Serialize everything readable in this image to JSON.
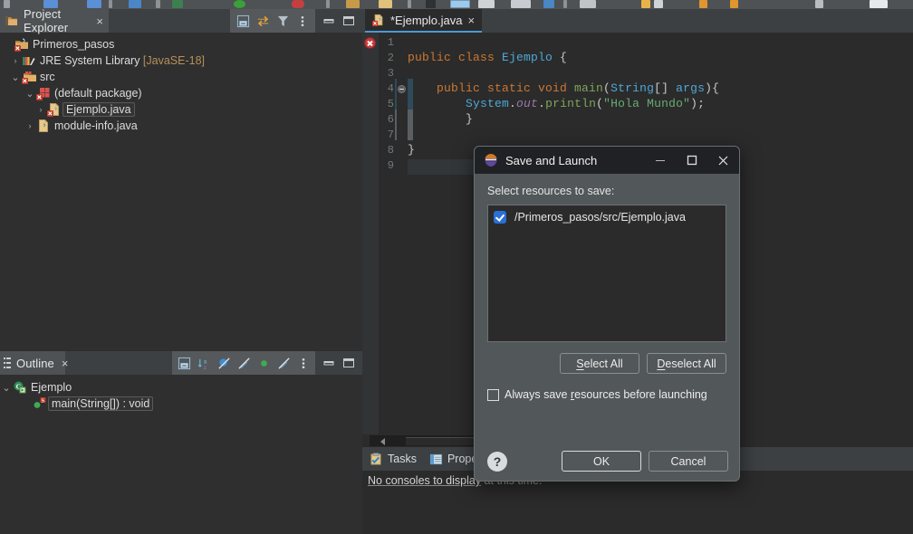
{
  "app": {
    "theme_bg": "#2f2f2f",
    "accent": "#4a9ad4"
  },
  "project_explorer": {
    "tab_label": "Project Explorer",
    "tab_close": "×",
    "tab_icon": "project-explorer-icon",
    "toolbar": [
      {
        "name": "collapse-all-icon",
        "glyph": ""
      },
      {
        "name": "link-with-editor-icon",
        "glyph": ""
      },
      {
        "name": "filter-icon",
        "glyph": ""
      },
      {
        "name": "view-menu-icon",
        "glyph": "⋮"
      },
      {
        "name": "minimize-view-icon",
        "glyph": ""
      },
      {
        "name": "maximize-view-icon",
        "glyph": ""
      }
    ],
    "tree": [
      {
        "twist": "",
        "indent": 0,
        "icon": "java-project-icon",
        "label": "Primeros_pasos",
        "suffix": "",
        "selected": false
      },
      {
        "twist": "›",
        "indent": 1,
        "icon": "jre-library-icon",
        "label": "JRE System Library ",
        "suffix": "[JavaSE-18]",
        "selected": false
      },
      {
        "twist": "⌄",
        "indent": 1,
        "icon": "source-folder-icon",
        "label": "src",
        "suffix": "",
        "selected": false
      },
      {
        "twist": "⌄",
        "indent": 2,
        "icon": "package-icon",
        "label": "(default package)",
        "suffix": "",
        "selected": false
      },
      {
        "twist": "›",
        "indent": 3,
        "icon": "java-file-icon",
        "label": "Ejemplo.java",
        "suffix": "",
        "selected": true
      },
      {
        "twist": "›",
        "indent": 2,
        "icon": "module-info-icon",
        "label": "module-info.java",
        "suffix": "",
        "selected": false
      }
    ]
  },
  "outline": {
    "tab_label": "Outline",
    "tab_close": "×",
    "tab_icon": "outline-icon",
    "toolbar": [
      {
        "name": "collapse-all-icon"
      },
      {
        "name": "sort-alphabetically-icon"
      },
      {
        "name": "hide-fields-icon"
      },
      {
        "name": "hide-static-members-icon"
      },
      {
        "name": "hide-non-public-icon"
      },
      {
        "name": "hide-local-types-icon"
      },
      {
        "name": "view-menu-icon"
      },
      {
        "name": "minimize-view-icon"
      },
      {
        "name": "maximize-view-icon"
      }
    ],
    "tree": [
      {
        "twist": "⌄",
        "indent": 0,
        "icon": "class-icon",
        "label": "Ejemplo"
      },
      {
        "twist": "",
        "indent": 1,
        "icon": "public-static-method-icon",
        "label": "main(String[]) : void"
      }
    ]
  },
  "editor": {
    "tab_label": "*Ejemplo.java",
    "tab_close": "×",
    "tab_icon": "java-file-icon",
    "error_marker": "error-marker-icon",
    "line_numbers": [
      "1",
      "2",
      "3",
      "4",
      "5",
      "6",
      "7",
      "8",
      "9"
    ],
    "current_line": 9,
    "code": [
      {
        "n": 1,
        "tokens": []
      },
      {
        "n": 2,
        "tokens": [
          {
            "t": "public class ",
            "c": "kw"
          },
          {
            "t": "Ejemplo",
            "c": "cls"
          },
          {
            "t": " {",
            "c": "pl"
          }
        ]
      },
      {
        "n": 3,
        "tokens": []
      },
      {
        "n": 4,
        "tokens": [
          {
            "t": "    public static void ",
            "c": "kw"
          },
          {
            "t": "main",
            "c": "mth"
          },
          {
            "t": "(",
            "c": "pl"
          },
          {
            "t": "String",
            "c": "ty"
          },
          {
            "t": "[] ",
            "c": "pl"
          },
          {
            "t": "args",
            "c": "ty"
          },
          {
            "t": "){",
            "c": "pl"
          }
        ]
      },
      {
        "n": 5,
        "tokens": [
          {
            "t": "        ",
            "c": "pl"
          },
          {
            "t": "System",
            "c": "ty"
          },
          {
            "t": ".",
            "c": "pl"
          },
          {
            "t": "out",
            "c": "fld"
          },
          {
            "t": ".",
            "c": "pl"
          },
          {
            "t": "println",
            "c": "mth"
          },
          {
            "t": "(",
            "c": "pl"
          },
          {
            "t": "\"Hola Mundo\"",
            "c": "st"
          },
          {
            "t": ");",
            "c": "pl"
          }
        ]
      },
      {
        "n": 6,
        "tokens": [
          {
            "t": "        }",
            "c": "pl"
          }
        ]
      },
      {
        "n": 7,
        "tokens": []
      },
      {
        "n": 8,
        "tokens": [
          {
            "t": "}",
            "c": "pl"
          }
        ]
      },
      {
        "n": 9,
        "tokens": []
      }
    ],
    "hscroll_left_arrow": "scroll-left-arrow-icon"
  },
  "bottom_panel": {
    "tabs": [
      {
        "label": "Tasks",
        "icon": "tasks-icon"
      },
      {
        "label": "Propert",
        "icon": "properties-icon"
      }
    ],
    "console_message_primary": "No consoles to display",
    "console_message_secondary": " at this time."
  },
  "dialog": {
    "title": "Save and Launch",
    "title_icon": "eclipse-logo-icon",
    "window_buttons": [
      {
        "name": "minimize-button",
        "glyph": "—"
      },
      {
        "name": "maximize-button",
        "glyph": "☐"
      },
      {
        "name": "close-button",
        "glyph": "✕"
      }
    ],
    "prompt": "Select resources to save:",
    "resources": [
      {
        "path": "/Primeros_pasos/src/Ejemplo.java",
        "checked": true
      }
    ],
    "select_all_label": "Select All",
    "select_all_mnemonic": "S",
    "deselect_all_label": "Deselect All",
    "deselect_all_mnemonic": "D",
    "always_save_label": "Always save resources before launching",
    "always_save_mnemonic": "r",
    "always_save_checked": false,
    "help_label": "?",
    "ok_label": "OK",
    "cancel_label": "Cancel"
  }
}
